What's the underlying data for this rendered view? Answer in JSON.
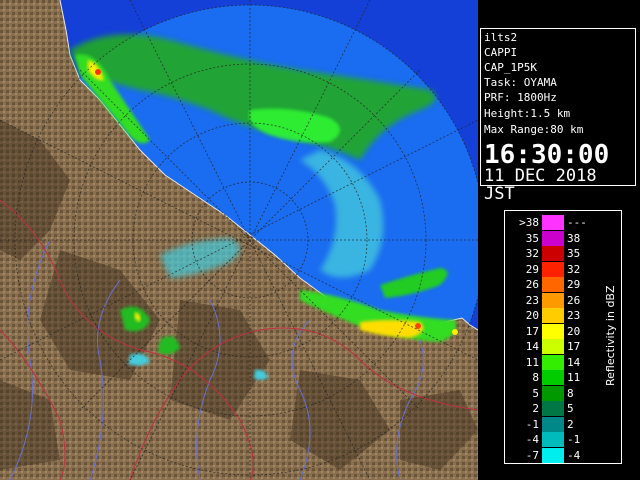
{
  "info": {
    "lines": [
      "ilts2",
      "CAPPI",
      "CAP_1P5K",
      "Task: OYAMA",
      "PRF: 1800Hz",
      "Height:1.5 km",
      "Max Range:80 km"
    ],
    "time": "16:30:00",
    "date": "11 DEC 2018 JST"
  },
  "legend": {
    "title": "Reflectivity in dBZ",
    "rows": [
      {
        "lo": ">38",
        "hi": "---",
        "color": "#ff33ff"
      },
      {
        "lo": "35",
        "hi": "38",
        "color": "#cc00cc"
      },
      {
        "lo": "32",
        "hi": "35",
        "color": "#cc0000"
      },
      {
        "lo": "29",
        "hi": "32",
        "color": "#ff2200"
      },
      {
        "lo": "26",
        "hi": "29",
        "color": "#ff6600"
      },
      {
        "lo": "23",
        "hi": "26",
        "color": "#ff9900"
      },
      {
        "lo": "20",
        "hi": "23",
        "color": "#ffcc00"
      },
      {
        "lo": "17",
        "hi": "20",
        "color": "#ffff00"
      },
      {
        "lo": "14",
        "hi": "17",
        "color": "#ccff00"
      },
      {
        "lo": "11",
        "hi": "14",
        "color": "#33ee00"
      },
      {
        "lo": "8",
        "hi": "11",
        "color": "#00cc00"
      },
      {
        "lo": "5",
        "hi": "8",
        "color": "#009900"
      },
      {
        "lo": "2",
        "hi": "5",
        "color": "#007744"
      },
      {
        "lo": "-1",
        "hi": "2",
        "color": "#008888"
      },
      {
        "lo": "-4",
        "hi": "-1",
        "color": "#00bbbb"
      },
      {
        "lo": "-7",
        "hi": "-4",
        "color": "#00eeee"
      }
    ]
  },
  "colors": {
    "sea": "#1a6cf0",
    "land": "#8a7050",
    "land_dark": "#5a4630",
    "echo_weak": "#55dde0",
    "echo_green": "#22bb22",
    "echo_strong": "#ffee00"
  }
}
